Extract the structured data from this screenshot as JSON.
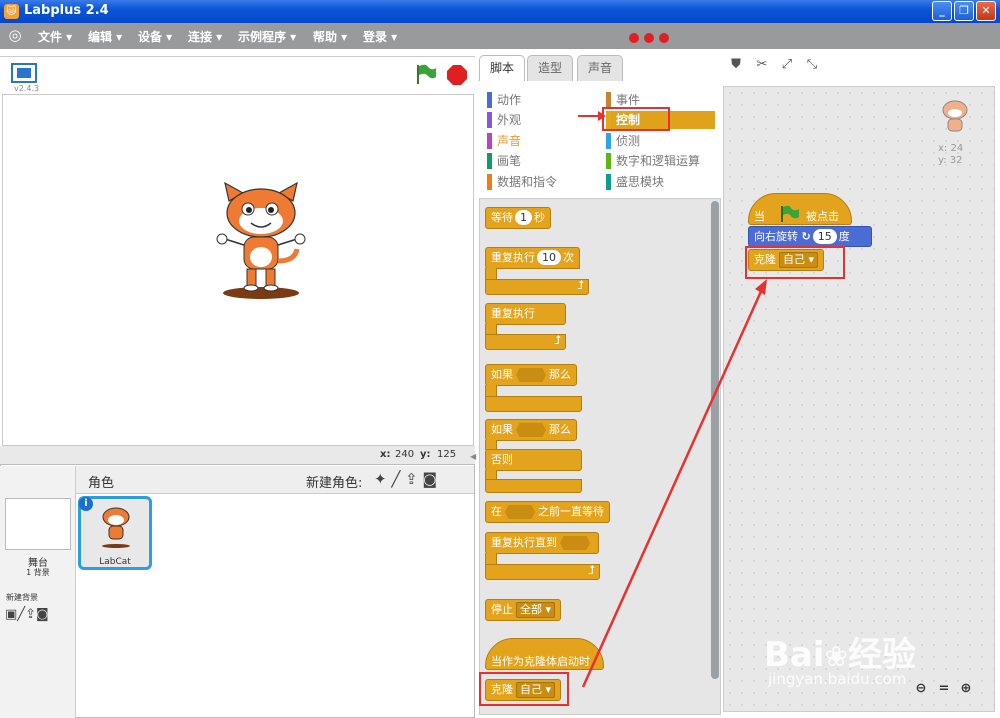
{
  "window": {
    "title": "Labplus 2.4",
    "minimize": "_",
    "maximize": "❐",
    "close": "✕"
  },
  "menu": {
    "items": [
      "文件 ▾",
      "编辑 ▾",
      "设备 ▾",
      "连接 ▾",
      "示例程序 ▾",
      "帮助 ▾",
      "登录 ▾"
    ]
  },
  "stage": {
    "version": "v2.4.3",
    "coords": {
      "x_label": "x:",
      "x": "240",
      "y_label": "y:",
      "y": "125"
    }
  },
  "sprites": {
    "header": "角色",
    "new_sprite_label": "新建角色:",
    "stage_label": "舞台",
    "stage_backdrop_count": "1 背景",
    "new_backdrop_label": "新建背景",
    "sprite_name": "LabCat"
  },
  "tabs": [
    "脚本",
    "造型",
    "声音"
  ],
  "categories": {
    "left": [
      {
        "label": "动作",
        "color": "#4a6cd4"
      },
      {
        "label": "外观",
        "color": "#8a55d7"
      },
      {
        "label": "声音",
        "color": "#bb42c3"
      },
      {
        "label": "画笔",
        "color": "#0e9a6c"
      },
      {
        "label": "数据和指令",
        "color": "#ee7d16"
      }
    ],
    "right": [
      {
        "label": "事件",
        "color": "#c88330"
      },
      {
        "label": "控制",
        "color": "#e1a91a"
      },
      {
        "label": "侦测",
        "color": "#2ca5e2"
      },
      {
        "label": "数字和逻辑运算",
        "color": "#5cb712"
      },
      {
        "label": "盛思模块",
        "color": "#0d9e8f"
      }
    ]
  },
  "palette": {
    "wait": {
      "label": "等待",
      "value": "1",
      "suffix": "秒"
    },
    "repeat": {
      "label": "重复执行",
      "value": "10",
      "suffix": "次"
    },
    "forever": {
      "label": "重复执行"
    },
    "if_then": {
      "label": "如果",
      "then": "那么"
    },
    "if_else": {
      "label": "如果",
      "then": "那么",
      "else": "否则"
    },
    "wait_until": {
      "label": "在",
      "suffix": "之前一直等待"
    },
    "repeat_until": {
      "label": "重复执行直到"
    },
    "stop": {
      "label": "停止",
      "option": "全部"
    },
    "clone_start": {
      "label": "当作为克隆体启动时"
    },
    "clone": {
      "label": "克隆",
      "option": "自己"
    }
  },
  "script": {
    "hat_prefix": "当",
    "hat_suffix": "被点击",
    "turn": {
      "label": "向右旋转",
      "value": "15",
      "suffix": "度"
    },
    "clone": {
      "label": "克隆",
      "option": "自己"
    },
    "sprite_coords": {
      "x_label": "x:",
      "x": "24",
      "y_label": "y:",
      "y": "32"
    }
  },
  "watermark": {
    "brand": "Bai",
    "brand_cn": "经验",
    "url": "jingyan.baidu.com"
  },
  "colors": {
    "control": "#e3a31c",
    "motion": "#4a6cd4",
    "highlight": "#e8312f",
    "menu": "#999a9c"
  }
}
